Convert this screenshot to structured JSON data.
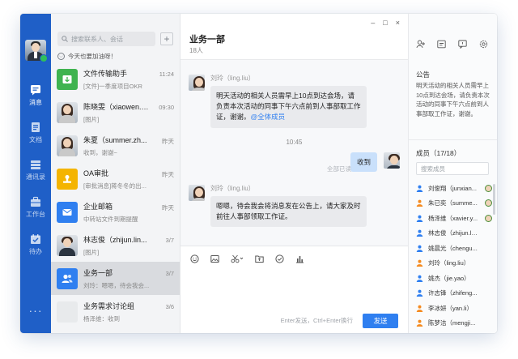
{
  "nav": {
    "items": [
      {
        "label": "消息",
        "icon": "message-icon",
        "active": true
      },
      {
        "label": "文档",
        "icon": "document-icon",
        "active": false
      },
      {
        "label": "通讯录",
        "icon": "contacts-icon",
        "active": false
      },
      {
        "label": "工作台",
        "icon": "workbench-icon",
        "active": false
      },
      {
        "label": "待办",
        "icon": "todo-icon",
        "active": false
      }
    ],
    "more": "···"
  },
  "search": {
    "placeholder": "搜索联系人、会话",
    "add": "+"
  },
  "motto": "今天也要加油呀！",
  "conversations": [
    {
      "name": "文件传输助手",
      "preview": "[文件]一季度项目OKR",
      "time": "11:24"
    },
    {
      "name": "陈晓雯（xiaowen.c...",
      "preview": "[图片]",
      "time": "09:30"
    },
    {
      "name": "朱夏（summer.zh...",
      "preview": "收到，谢谢~",
      "time": "昨天"
    },
    {
      "name": "OA审批",
      "preview": "[审批消息]蒋冬冬的出...",
      "time": "昨天"
    },
    {
      "name": "企业邮箱",
      "preview": "中转站文件到期提醒",
      "time": "昨天"
    },
    {
      "name": "林志俊（zhijun.lin...",
      "preview": "[图片]",
      "time": "3/7"
    },
    {
      "name": "业务一部",
      "preview": "刘玲：嗯嗯，待会我会...",
      "time": "3/7"
    },
    {
      "name": "业务需求讨论组",
      "preview": "杨泽维：收到",
      "time": "3/6"
    }
  ],
  "chat": {
    "title": "业务一部",
    "subtitle": "18人",
    "window": {
      "minimize": "–",
      "maximize": "□",
      "close": "×"
    },
    "messages": [
      {
        "sender": "刘玲（ling.liu）",
        "text": "明天活动的相关人员需早上10点到达会场，请负责本次活动的同事下午六点前到人事部取工作证，谢谢。",
        "mention": "@全体成员"
      },
      {
        "sender": "刘玲（ling.liu）",
        "text": "嗯嗯，待会我会将消息发在公告上，请大家及时前往人事部领取工作证。"
      }
    ],
    "timestamp": "10:45",
    "my_reply": "收到",
    "read_status": "全部已读",
    "send_hint": "Enter发送，Ctrl+Enter换行",
    "send_label": "发送"
  },
  "side": {
    "notice_title": "公告",
    "notice_text": "明天活动的相关人员需早上10点到达会场，请负责本次活动的同事下午六点前到人事部取工作证，谢谢。",
    "members_title": "成员（17/18）",
    "member_search_placeholder": "搜索成员",
    "members": [
      {
        "name": "刘俊翔（junxian...",
        "color": "#2f7ff0",
        "badge": true
      },
      {
        "name": "朱已奕（summe...",
        "color": "#f58a1f",
        "badge": true
      },
      {
        "name": "杨泽维（xavier.y...",
        "color": "#2f7ff0",
        "badge": true
      },
      {
        "name": "林志俊（zhijun.lin）",
        "color": "#2f7ff0",
        "badge": false
      },
      {
        "name": "姚晨光（chengu...",
        "color": "#2f7ff0",
        "badge": false
      },
      {
        "name": "刘玲（ling.liu）",
        "color": "#f58a1f",
        "badge": false
      },
      {
        "name": "姚杰（jie.yao）",
        "color": "#2f7ff0",
        "badge": false
      },
      {
        "name": "许志锋（zhifeng...",
        "color": "#2f7ff0",
        "badge": false
      },
      {
        "name": "李冰妍（yan.li）",
        "color": "#f58a1f",
        "badge": false
      },
      {
        "name": "陈梦洁（mengji...",
        "color": "#f58a1f",
        "badge": false
      }
    ]
  }
}
